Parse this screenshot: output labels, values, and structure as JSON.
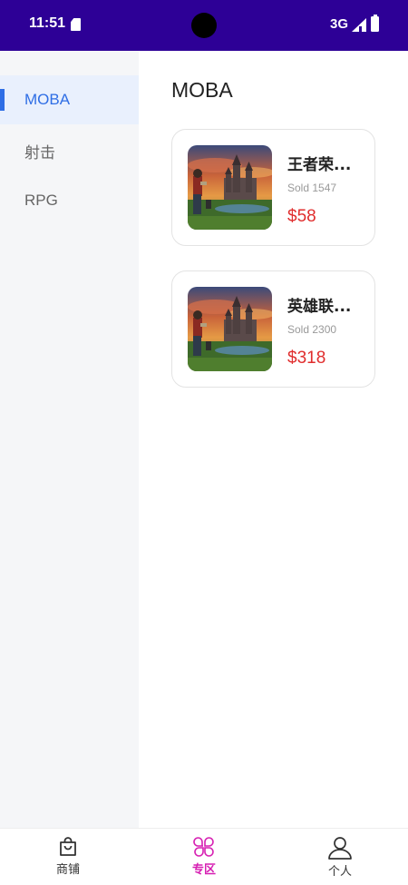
{
  "status_bar": {
    "time": "11:51",
    "network": "3G",
    "icons": [
      "sd-card-icon",
      "signal-icon",
      "battery-icon"
    ],
    "background": "#2d0096"
  },
  "sidebar": {
    "items": [
      {
        "label": "MOBA",
        "active": true
      },
      {
        "label": "射击",
        "active": false
      },
      {
        "label": "RPG",
        "active": false
      }
    ],
    "active_color": "#2f6ee5"
  },
  "main": {
    "title": "MOBA",
    "products": [
      {
        "name": "王者荣...",
        "sold": "Sold 1547",
        "price": "$58"
      },
      {
        "name": "英雄联...",
        "sold": "Sold 2300",
        "price": "$318"
      }
    ]
  },
  "tabbar": {
    "tabs": [
      {
        "label": "商铺",
        "icon": "shopping-bag-icon",
        "active": false
      },
      {
        "label": "专区",
        "icon": "clover-grid-icon",
        "active": true
      },
      {
        "label": "个人",
        "icon": "person-icon",
        "active": false
      }
    ],
    "active_color": "#d61fb2"
  }
}
